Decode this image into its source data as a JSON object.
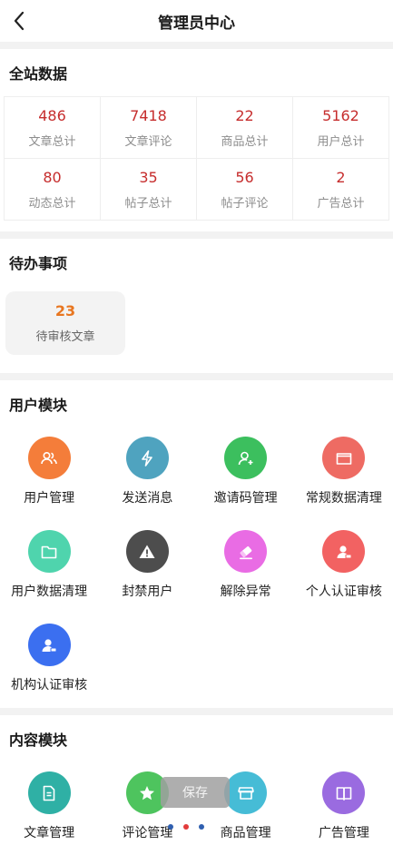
{
  "header": {
    "title": "管理员中心",
    "back_icon": "chevron-left-icon"
  },
  "site_data": {
    "title": "全站数据",
    "stats": [
      {
        "value": "486",
        "label": "文章总计"
      },
      {
        "value": "7418",
        "label": "文章评论"
      },
      {
        "value": "22",
        "label": "商品总计"
      },
      {
        "value": "5162",
        "label": "用户总计"
      },
      {
        "value": "80",
        "label": "动态总计"
      },
      {
        "value": "35",
        "label": "帖子总计"
      },
      {
        "value": "56",
        "label": "帖子评论"
      },
      {
        "value": "2",
        "label": "广告总计"
      }
    ]
  },
  "todo": {
    "title": "待办事项",
    "items": [
      {
        "value": "23",
        "label": "待审核文章"
      }
    ]
  },
  "user_module": {
    "title": "用户模块",
    "items": [
      {
        "label": "用户管理",
        "icon": "users-icon",
        "color": "#f47d3a"
      },
      {
        "label": "发送消息",
        "icon": "lightning-icon",
        "color": "#4fa3bf"
      },
      {
        "label": "邀请码管理",
        "icon": "user-add-icon",
        "color": "#3cbf5e"
      },
      {
        "label": "常规数据清理",
        "icon": "folder-icon",
        "color": "#ee6b63"
      },
      {
        "label": "用户数据清理",
        "icon": "folder-icon",
        "color": "#4fd4ad"
      },
      {
        "label": "封禁用户",
        "icon": "warning-icon",
        "color": "#4d4d4d"
      },
      {
        "label": "解除异常",
        "icon": "eraser-icon",
        "color": "#e96ce4"
      },
      {
        "label": "个人认证审核",
        "icon": "person-badge-icon",
        "color": "#f26262"
      },
      {
        "label": "机构认证审核",
        "icon": "org-badge-icon",
        "color": "#3b6ff0"
      }
    ]
  },
  "content_module": {
    "title": "内容模块",
    "items": [
      {
        "label": "文章管理",
        "icon": "document-icon",
        "color": "#2fb0a5"
      },
      {
        "label": "评论管理",
        "icon": "star-icon",
        "color": "#4ec45e"
      },
      {
        "label": "商品管理",
        "icon": "store-icon",
        "color": "#46bcd6"
      },
      {
        "label": "广告管理",
        "icon": "book-icon",
        "color": "#9a6be0"
      }
    ]
  },
  "toast": {
    "text": "保存"
  },
  "indicator_dots": [
    "#2f5fb0",
    "#e23b3b",
    "#2f5fb0"
  ]
}
